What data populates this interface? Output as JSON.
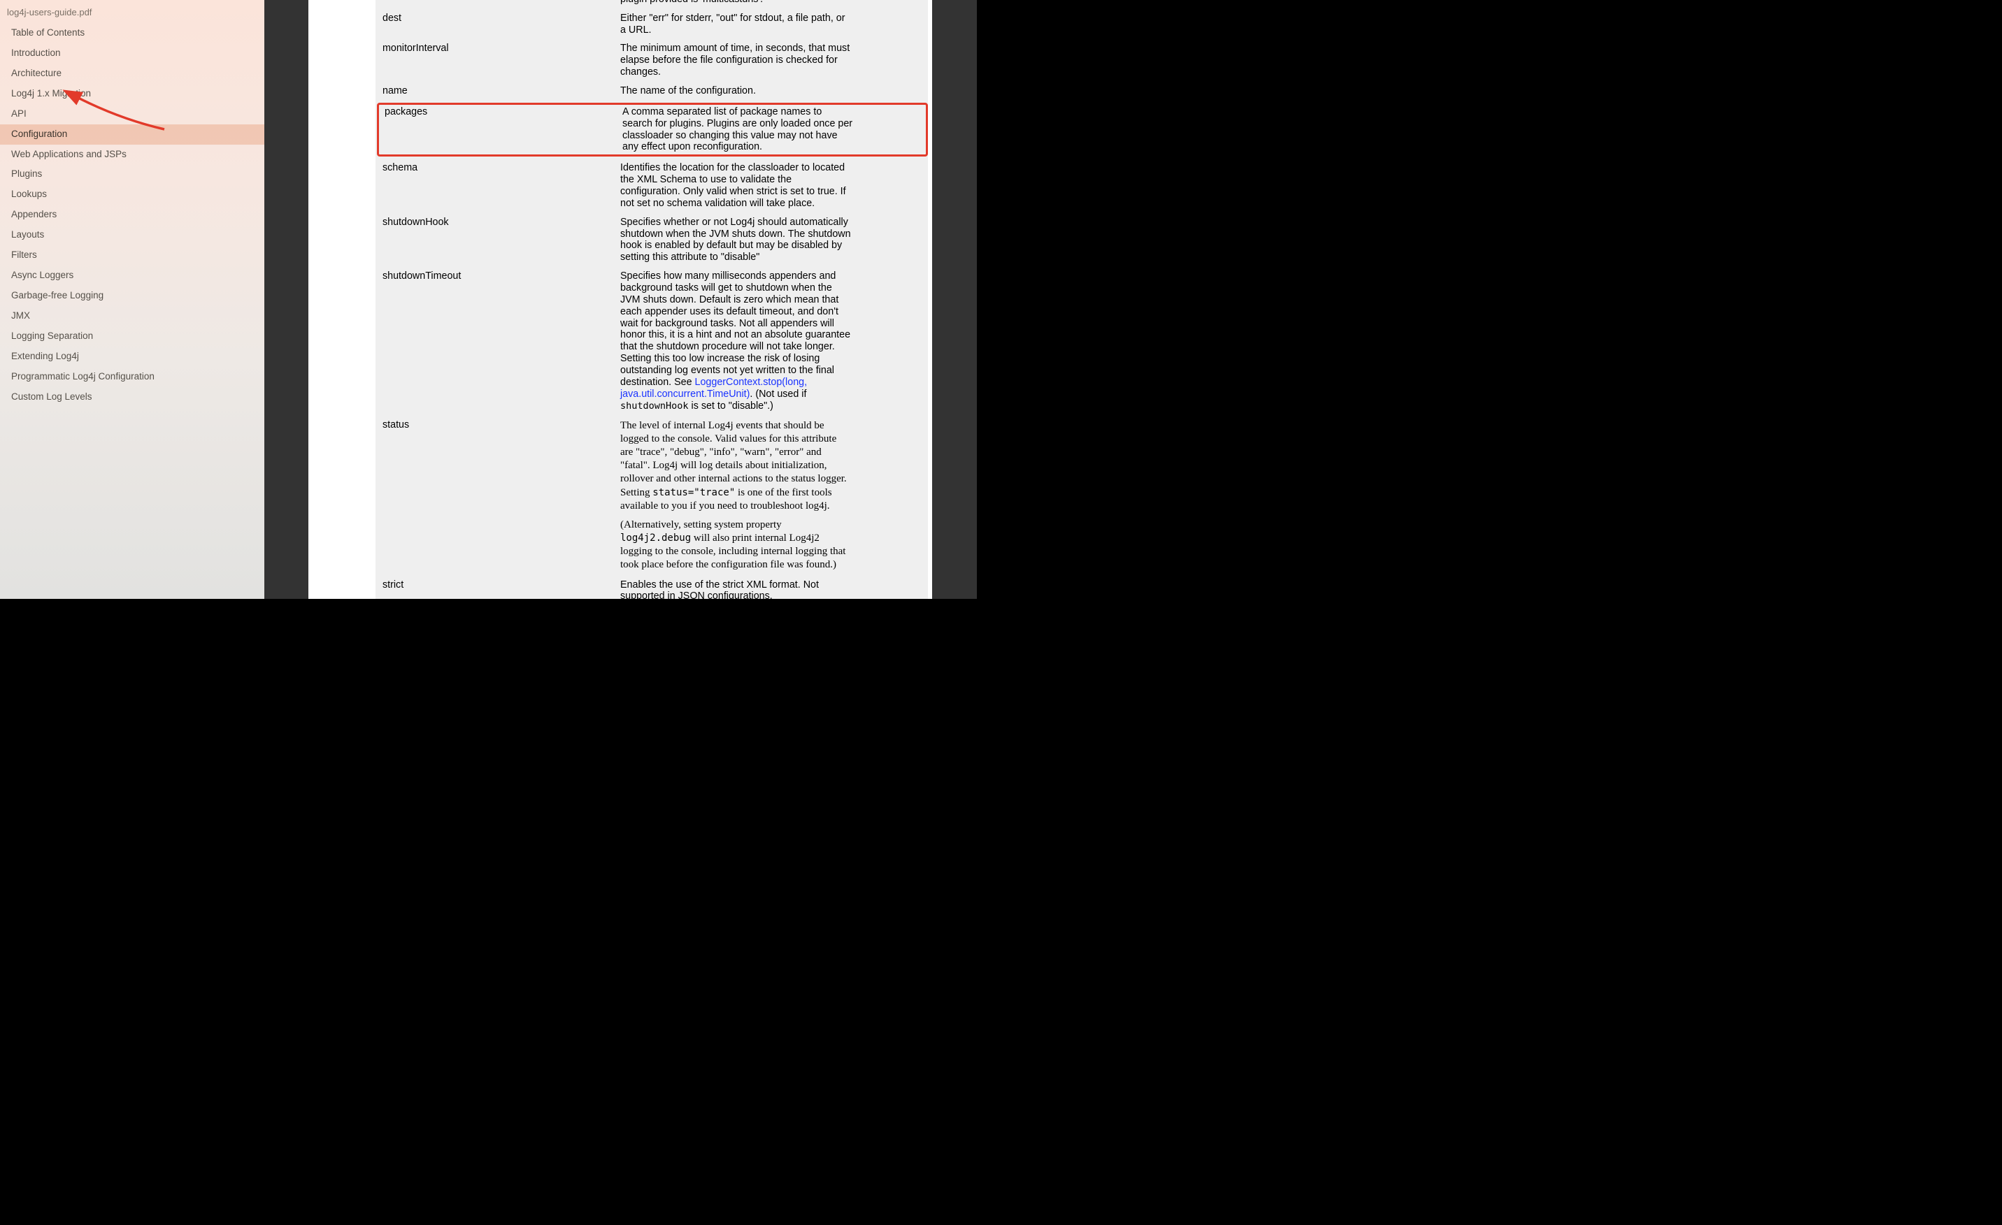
{
  "document": {
    "title": "log4j-users-guide.pdf"
  },
  "toc": {
    "items": [
      {
        "label": "Table of Contents"
      },
      {
        "label": "Introduction"
      },
      {
        "label": "Architecture"
      },
      {
        "label": "Log4j 1.x Migration"
      },
      {
        "label": "API"
      },
      {
        "label": "Configuration",
        "active": true
      },
      {
        "label": "Web Applications and JSPs"
      },
      {
        "label": "Plugins"
      },
      {
        "label": "Lookups"
      },
      {
        "label": "Appenders"
      },
      {
        "label": "Layouts"
      },
      {
        "label": "Filters"
      },
      {
        "label": "Async Loggers"
      },
      {
        "label": "Garbage-free Logging"
      },
      {
        "label": "JMX"
      },
      {
        "label": "Logging Separation"
      },
      {
        "label": "Extending Log4j"
      },
      {
        "label": "Programmatic Log4j Configuration"
      },
      {
        "label": "Custom Log Levels"
      }
    ]
  },
  "table": {
    "rows": [
      {
        "attr": "",
        "desc_parts": [
          {
            "t": "text",
            "v": "SocketAppender configurations. The only Advertiser plugin provided is 'multicastdns'."
          }
        ]
      },
      {
        "attr": "dest",
        "desc_parts": [
          {
            "t": "text",
            "v": "Either \"err\" for stderr, \"out\" for stdout, a file path, or a URL."
          }
        ]
      },
      {
        "attr": "monitorInterval",
        "desc_parts": [
          {
            "t": "text",
            "v": "The minimum amount of time, in seconds, that must elapse before the file configuration is checked for changes."
          }
        ]
      },
      {
        "attr": "name",
        "desc_parts": [
          {
            "t": "text",
            "v": "The name of the configuration."
          }
        ]
      },
      {
        "attr": "packages",
        "highlight": true,
        "desc_parts": [
          {
            "t": "text",
            "v": "A comma separated list of package names to search for plugins. Plugins are only loaded once per classloader so changing this value may not have any effect upon reconfiguration."
          }
        ]
      },
      {
        "attr": "schema",
        "desc_parts": [
          {
            "t": "text",
            "v": "Identifies the location for the classloader to located the XML Schema to use to validate the configuration. Only valid when strict is set to true. If not set no schema validation will take place."
          }
        ]
      },
      {
        "attr": "shutdownHook",
        "desc_parts": [
          {
            "t": "text",
            "v": "Specifies whether or not Log4j should automatically shutdown when the JVM shuts down. The shutdown hook is enabled by default but may be disabled by setting this attribute to \"disable\""
          }
        ]
      },
      {
        "attr": "shutdownTimeout",
        "desc_parts": [
          {
            "t": "text",
            "v": "Specifies how many milliseconds appenders and background tasks will get to shutdown when the JVM shuts down. Default is zero which mean that each appender uses its default timeout, and don't wait for background tasks. Not all appenders will honor this, it is a hint and not an absolute guarantee that the shutdown procedure will not take longer. Setting this too low increase the risk of losing outstanding log events not yet written to the final destination. See  "
          },
          {
            "t": "link",
            "v": "LoggerContext.stop(long, java.util.concurrent.TimeUnit)"
          },
          {
            "t": "text",
            "v": ". (Not used if "
          },
          {
            "t": "code",
            "v": "shutdownHook"
          },
          {
            "t": "text",
            "v": " is set to \"disable\".)"
          }
        ]
      },
      {
        "attr": "status",
        "serif": true,
        "desc_parts": [
          {
            "t": "text",
            "v": "The level of internal Log4j events that should be logged to the console. Valid values for this attribute are \"trace\", \"debug\", \"info\", \"warn\", \"error\" and \"fatal\". Log4j will log details about initialization, rollover and other internal actions to the status logger. Setting "
          },
          {
            "t": "code",
            "v": "status=\"trace\""
          },
          {
            "t": "text",
            "v": " is one of the first tools available to you if you need to troubleshoot log4j."
          }
        ],
        "desc2_parts": [
          {
            "t": "text",
            "v": "(Alternatively, setting system property "
          },
          {
            "t": "code",
            "v": "log4j2.debug"
          },
          {
            "t": "text",
            "v": " will also print internal Log4j2 logging to the console, including internal logging that took place before the configuration file was found.)"
          }
        ]
      },
      {
        "attr": "strict",
        "desc_parts": [
          {
            "t": "text",
            "v": "Enables the use of the strict XML format. Not supported in JSON configurations."
          }
        ]
      }
    ]
  },
  "annotation": {
    "arrow_color": "#e23a2a"
  }
}
